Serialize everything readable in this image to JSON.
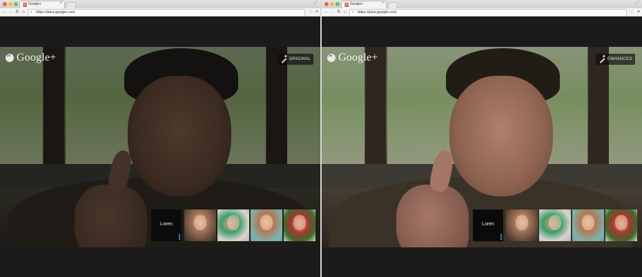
{
  "windows": [
    {
      "id": "left",
      "tab_title": "Google+",
      "favicon_text": "g+",
      "url": "https://plus.google.com",
      "brand": "Google+",
      "mode_label": "ORIGINAL",
      "speaker_name": "Loren"
    },
    {
      "id": "right",
      "tab_title": "Google+",
      "favicon_text": "g+",
      "url": "https://plus.google.com",
      "brand": "Google+",
      "mode_label": "ENHANCED",
      "speaker_name": "Loren"
    }
  ],
  "icons": {
    "back": "←",
    "forward": "→",
    "reload": "↻",
    "home": "⌂",
    "lock": "🔒",
    "star": "☆",
    "menu": "≡",
    "close": "×",
    "fullscreen": "⤢"
  },
  "colors": {
    "accent_mic": "#3bb3e6",
    "favicon": "#dd4b39",
    "lock": "#3b9b3b"
  }
}
